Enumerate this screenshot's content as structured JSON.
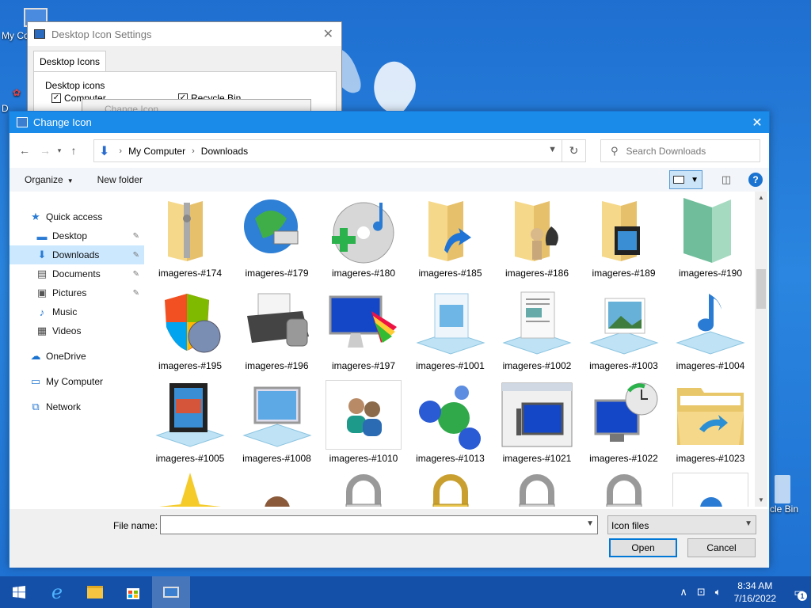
{
  "desktop": {
    "icons": [
      {
        "label": "My Co"
      },
      {
        "label": "D"
      },
      {
        "label": "cle Bin"
      }
    ]
  },
  "bg_dialog": {
    "title": "Desktop Icon Settings",
    "tab": "Desktop Icons",
    "group": "Desktop icons",
    "check_computer": "Computer",
    "check_recycle": "Recycle Bin",
    "ghost_title": "Change Icon"
  },
  "dialog": {
    "title": "Change Icon",
    "breadcrumb": [
      "My Computer",
      "Downloads"
    ],
    "search_placeholder": "Search Downloads",
    "toolbar": {
      "organize": "Organize",
      "new_folder": "New folder",
      "help": "?"
    },
    "nav": [
      {
        "label": "Quick access",
        "icon": "star-icon",
        "glyph": "★",
        "color": "#2a7bd4"
      },
      {
        "label": "Desktop",
        "icon": "desktop-icon",
        "glyph": "▬",
        "color": "#2a7bd4",
        "sub": true,
        "pin": true
      },
      {
        "label": "Downloads",
        "icon": "download-icon",
        "glyph": "⬇",
        "color": "#2a7bd4",
        "sub": true,
        "pin": true,
        "selected": true
      },
      {
        "label": "Documents",
        "icon": "document-icon",
        "glyph": "▤",
        "color": "#555",
        "sub": true,
        "pin": true
      },
      {
        "label": "Pictures",
        "icon": "picture-icon",
        "glyph": "▣",
        "color": "#555",
        "sub": true,
        "pin": true
      },
      {
        "label": "Music",
        "icon": "music-icon",
        "glyph": "♪",
        "color": "#2a7bd4",
        "sub": true
      },
      {
        "label": "Videos",
        "icon": "video-icon",
        "glyph": "▦",
        "color": "#444",
        "sub": true
      },
      {
        "label": "OneDrive",
        "icon": "cloud-icon",
        "glyph": "☁",
        "color": "#1a73d0",
        "gap": true
      },
      {
        "label": "My Computer",
        "icon": "computer-icon",
        "glyph": "▭",
        "color": "#2a7bd4",
        "gap": true
      },
      {
        "label": "Network",
        "icon": "network-icon",
        "glyph": "⧉",
        "color": "#2a7bd4",
        "gap": true
      }
    ],
    "files": [
      {
        "label": "imageres-#174",
        "icon": "zip-folder-icon"
      },
      {
        "label": "imageres-#179",
        "icon": "globe-network-icon"
      },
      {
        "label": "imageres-#180",
        "icon": "cd-music-add-icon"
      },
      {
        "label": "imageres-#185",
        "icon": "folder-shortcut-icon"
      },
      {
        "label": "imageres-#186",
        "icon": "games-folder-icon"
      },
      {
        "label": "imageres-#189",
        "icon": "video-folder-icon"
      },
      {
        "label": "imageres-#190",
        "icon": "green-folder-icon"
      },
      {
        "label": "imageres-#195",
        "icon": "windows-shield-icon"
      },
      {
        "label": "imageres-#196",
        "icon": "printer-icon"
      },
      {
        "label": "imageres-#197",
        "icon": "display-palette-icon"
      },
      {
        "label": "imageres-#1001",
        "icon": "document-stand-icon"
      },
      {
        "label": "imageres-#1002",
        "icon": "text-document-stand-icon"
      },
      {
        "label": "imageres-#1003",
        "icon": "picture-stand-icon"
      },
      {
        "label": "imageres-#1004",
        "icon": "music-stand-icon"
      },
      {
        "label": "imageres-#1005",
        "icon": "video-stand-icon"
      },
      {
        "label": "imageres-#1008",
        "icon": "monitor-stand-icon"
      },
      {
        "label": "imageres-#1010",
        "icon": "users-icon"
      },
      {
        "label": "imageres-#1013",
        "icon": "molecule-icon"
      },
      {
        "label": "imageres-#1021",
        "icon": "window-monitor-icon"
      },
      {
        "label": "imageres-#1022",
        "icon": "monitor-clock-icon"
      },
      {
        "label": "imageres-#1023",
        "icon": "open-folder-icon"
      },
      {
        "label": "",
        "icon": "star-partial-icon"
      },
      {
        "label": "",
        "icon": "user-partial-icon"
      },
      {
        "label": "",
        "icon": "lock-drive-icon"
      },
      {
        "label": "",
        "icon": "gold-lock-drive-icon"
      },
      {
        "label": "",
        "icon": "lock-drive-icon"
      },
      {
        "label": "",
        "icon": "dark-lock-drive-icon"
      },
      {
        "label": "",
        "icon": "pin-partial-icon"
      }
    ],
    "file_name_label": "File name:",
    "file_name_value": "",
    "file_type": "Icon files",
    "open": "Open",
    "cancel": "Cancel"
  },
  "taskbar": {
    "time": "8:34 AM",
    "date": "7/16/2022",
    "notifications": "1"
  },
  "colors": {
    "accent": "#1a8be8",
    "taskbar": "#1450a8",
    "selection": "#cce8ff"
  }
}
